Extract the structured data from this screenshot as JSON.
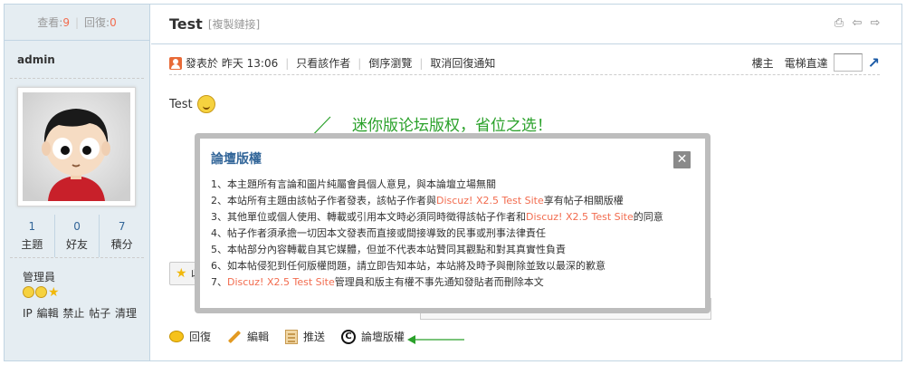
{
  "stats": {
    "views_label": "查看:",
    "views": "9",
    "replies_label": "回復:",
    "replies": "0"
  },
  "author": {
    "name": "admin",
    "group": "管理員",
    "counts": [
      {
        "value": "1",
        "label": "主題"
      },
      {
        "value": "0",
        "label": "好友"
      },
      {
        "value": "7",
        "label": "積分"
      }
    ],
    "admin_links": "IP 編輯 禁止 帖子 清理"
  },
  "thread": {
    "title": "Test",
    "copy_link": "[複製鏈接]"
  },
  "authorbar": {
    "posted": "發表於 昨天 13:06",
    "only_author": "只看該作者",
    "reverse": "倒序瀏覽",
    "cancel_notify": "取消回復通知",
    "floor_owner": "樓主",
    "elevator": "電梯直達"
  },
  "post": {
    "body": "Test"
  },
  "annotation": "迷你版论坛版权，省位之选！",
  "fav_label": "收",
  "popup": {
    "title": "論壇版權",
    "lines": [
      {
        "pre": "1、本主題所有言論和圖片純屬會員個人意見，與本論壇立場無關",
        "hl": "",
        "post": ""
      },
      {
        "pre": "2、本站所有主題由該帖子作者發表，該帖子作者與",
        "hl": "Discuz! X2.5 Test Site",
        "post": "享有帖子相關版權"
      },
      {
        "pre": "3、其他單位或個人使用、轉載或引用本文時必須同時徵得該帖子作者和",
        "hl": "Discuz! X2.5 Test Site",
        "post": "的同意"
      },
      {
        "pre": "4、帖子作者須承擔一切因本文發表而直接或間接導致的民事或刑事法律責任",
        "hl": "",
        "post": ""
      },
      {
        "pre": "5、本帖部分內容轉載自其它媒體，但並不代表本站贊同其觀點和對其真實性負責",
        "hl": "",
        "post": ""
      },
      {
        "pre": "6、如本帖侵犯到任何版權問題，請立即告知本站，本站將及時予與刪除並致以最深的歉意",
        "hl": "",
        "post": ""
      },
      {
        "pre": "7、",
        "hl": "Discuz! X2.5 Test Site",
        "post": "管理員和版主有權不事先通知發貼者而刪除本文"
      }
    ]
  },
  "actions": {
    "reply": "回復",
    "edit": "編輯",
    "push": "推送",
    "copyright": "論壇版權"
  },
  "colors": {
    "accent_orange": "#f26c4f",
    "link_blue": "#336699",
    "annotation_green": "#2aa12a"
  }
}
